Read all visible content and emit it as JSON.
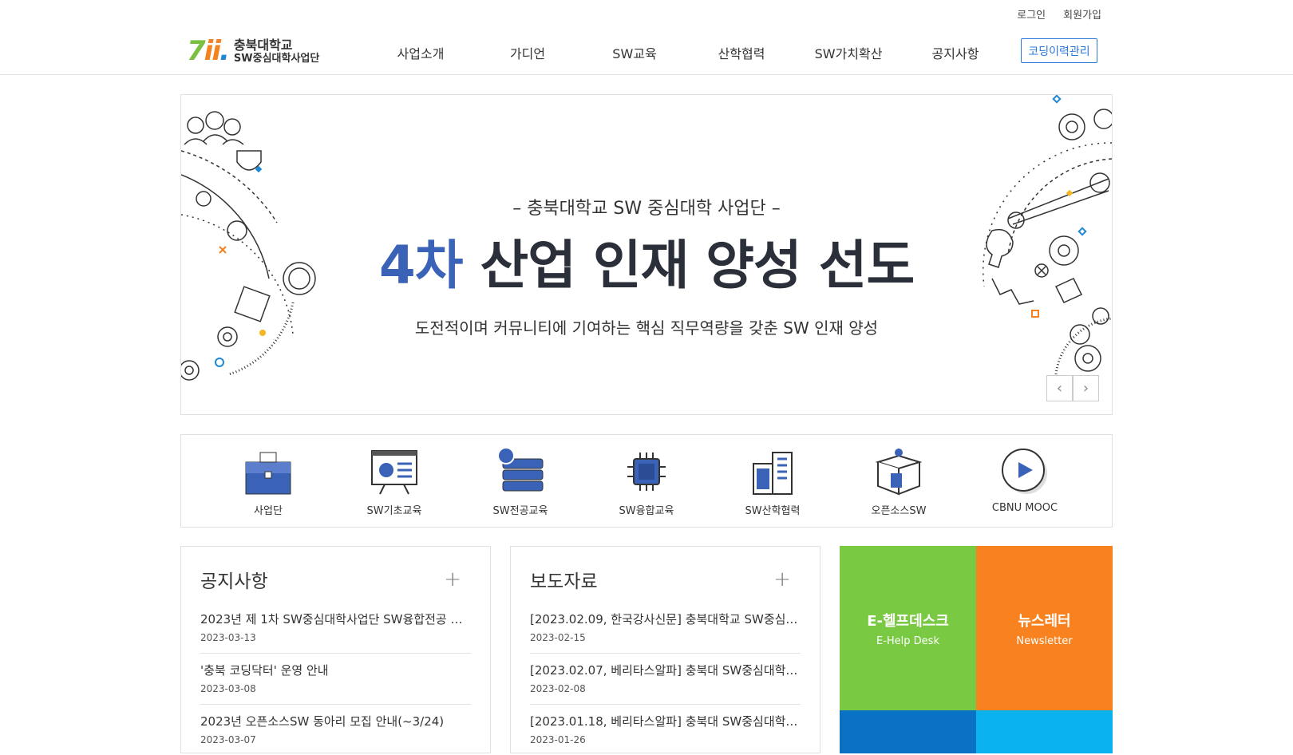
{
  "top_links": {
    "login": "로그인",
    "signup": "회원가입"
  },
  "logo": {
    "line1": "충북대학교",
    "line2": "SW중심대학사업단"
  },
  "nav": [
    "사업소개",
    "가디언",
    "SW교육",
    "산학협력",
    "SW가치확산",
    "공지사항"
  ],
  "coding_button": "코딩이력관리",
  "banner": {
    "subtitle": "– 충북대학교 SW 중심대학 사업단 –",
    "headline_accent": "4차",
    "headline_rest": "산업 인재 양성 선도",
    "description": "도전적이며 커뮤니티에 기여하는 핵심 직무역량을 갖춘 SW 인재 양성",
    "prev": "‹",
    "next": "›"
  },
  "quick_links": [
    {
      "label": "사업단",
      "icon": "briefcase-icon"
    },
    {
      "label": "SW기초교육",
      "icon": "presentation-board-icon"
    },
    {
      "label": "SW전공교육",
      "icon": "server-stack-icon"
    },
    {
      "label": "SW융합교육",
      "icon": "chip-icon"
    },
    {
      "label": "SW산학협력",
      "icon": "buildings-icon"
    },
    {
      "label": "오픈소스SW",
      "icon": "open-box-icon"
    },
    {
      "label": "CBNU MOOC",
      "icon": "play-icon"
    }
  ],
  "notice": {
    "title": "공지사항",
    "plus": "+",
    "items": [
      {
        "title": "2023년 제 1차 SW중심대학사업단 SW융합전공 간...",
        "date": "2023-03-13"
      },
      {
        "title": "'충북 코딩닥터' 운영 안내",
        "date": "2023-03-08"
      },
      {
        "title": "2023년 오픈소스SW 동아리 모집 안내(~3/24)",
        "date": "2023-03-07"
      }
    ]
  },
  "press": {
    "title": "보도자료",
    "plus": "+",
    "items": [
      {
        "title": "[2023.02.09, 한국강사신문] 충북대학교 SW중심대...",
        "date": "2023-02-15"
      },
      {
        "title": "[2023.02.07, 베리타스알파] 충북대 SW중심대학사...",
        "date": "2023-02-08"
      },
      {
        "title": "[2023.01.18, 베리타스알파] 충북대 SW중심대학사...",
        "date": "2023-01-26"
      }
    ]
  },
  "tiles": [
    {
      "title": "E-헬프데스크",
      "sub": "E-Help Desk",
      "color": "#7ac943"
    },
    {
      "title": "뉴스레터",
      "sub": "Newsletter",
      "color": "#f7821f"
    }
  ],
  "colors": {
    "accent": "#3a63b8",
    "button_blue": "#2b78d8",
    "tile_blue": "#0a72c4",
    "tile_cyan": "#0bb3ee"
  }
}
